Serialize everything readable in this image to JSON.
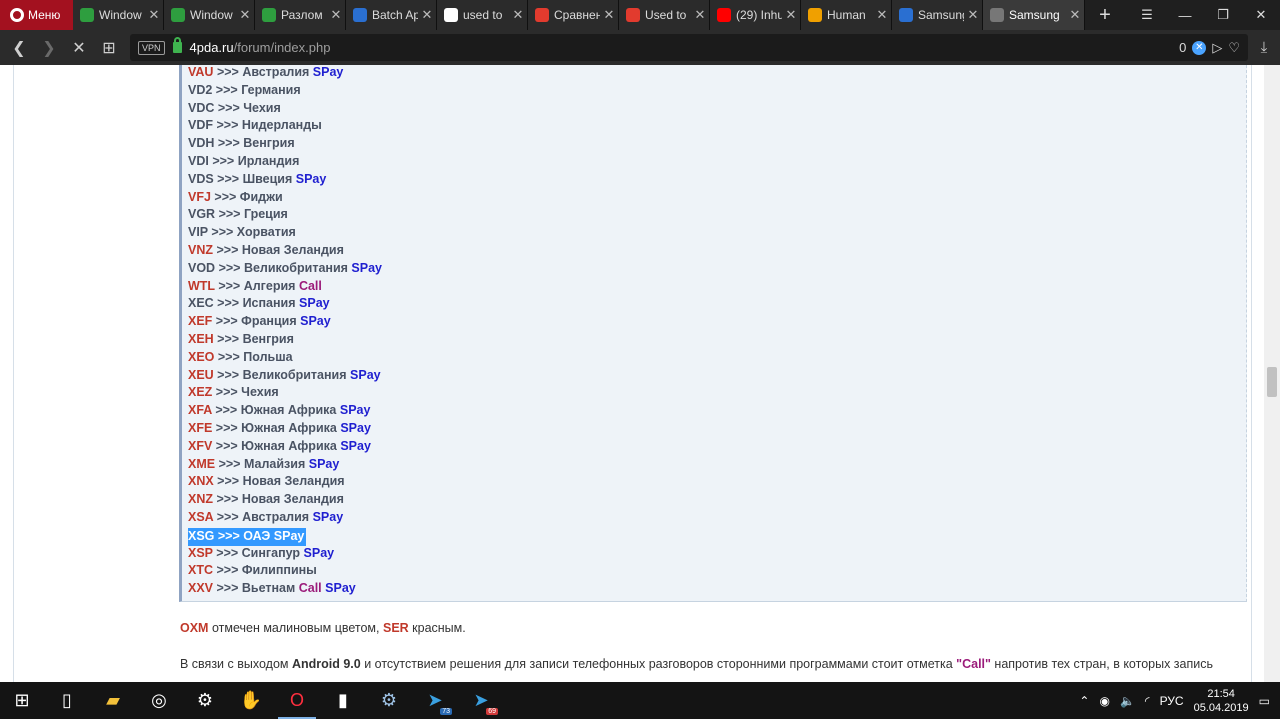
{
  "browser": {
    "menu_label": "Меню",
    "tabs": [
      {
        "title": "Window",
        "favicon_color": "#2e9e3f"
      },
      {
        "title": "Window",
        "favicon_color": "#2e9e3f"
      },
      {
        "title": "Разлом",
        "favicon_color": "#2e9e3f"
      },
      {
        "title": "Batch Ap",
        "favicon_color": "#2a6fd1"
      },
      {
        "title": "used to",
        "favicon_color": "#ffffff"
      },
      {
        "title": "Сравнен",
        "favicon_color": "#e23b2e"
      },
      {
        "title": "Used to",
        "favicon_color": "#e23b2e"
      },
      {
        "title": "(29) Inhu",
        "favicon_color": "#ff0000"
      },
      {
        "title": "Human",
        "favicon_color": "#f0a000"
      },
      {
        "title": "Samsung",
        "favicon_color": "#2a6fd1"
      },
      {
        "title": "Samsung",
        "favicon_color": "#777777",
        "active": true
      }
    ],
    "url_host": "4pda.ru",
    "url_path": "/forum/index.php",
    "vpn_label": "VPN",
    "adblock_count": "0"
  },
  "content": {
    "rows": [
      {
        "code": "VAU",
        "country": "Австралия",
        "spay": "SPay",
        "call": "",
        "code_red": true
      },
      {
        "code": "VD2",
        "country": "Германия",
        "spay": "",
        "call": "",
        "code_red": false
      },
      {
        "code": "VDC",
        "country": "Чехия",
        "spay": "",
        "call": "",
        "code_red": false
      },
      {
        "code": "VDF",
        "country": "Нидерланды",
        "spay": "",
        "call": "",
        "code_red": false
      },
      {
        "code": "VDH",
        "country": "Венгрия",
        "spay": "",
        "call": "",
        "code_red": false
      },
      {
        "code": "VDI",
        "country": "Ирландия",
        "spay": "",
        "call": "",
        "code_red": false
      },
      {
        "code": "VDS",
        "country": "Швеция",
        "spay": "SPay",
        "call": "",
        "code_red": false
      },
      {
        "code": "VFJ",
        "country": "Фиджи",
        "spay": "",
        "call": "",
        "code_red": true
      },
      {
        "code": "VGR",
        "country": "Греция",
        "spay": "",
        "call": "",
        "code_red": false
      },
      {
        "code": "VIP",
        "country": "Хорватия",
        "spay": "",
        "call": "",
        "code_red": false
      },
      {
        "code": "VNZ",
        "country": "Новая Зеландия",
        "spay": "",
        "call": "",
        "code_red": true
      },
      {
        "code": "VOD",
        "country": "Великобритания",
        "spay": "SPay",
        "call": "",
        "code_red": false
      },
      {
        "code": "WTL",
        "country": "Алгерия",
        "spay": "",
        "call": "Call",
        "code_red": true
      },
      {
        "code": "XEC",
        "country": "Испания",
        "spay": "SPay",
        "call": "",
        "code_red": false
      },
      {
        "code": "XEF",
        "country": "Франция",
        "spay": "SPay",
        "call": "",
        "code_red": true
      },
      {
        "code": "XEH",
        "country": "Венгрия",
        "spay": "",
        "call": "",
        "code_red": true
      },
      {
        "code": "XEO",
        "country": "Польша",
        "spay": "",
        "call": "",
        "code_red": true
      },
      {
        "code": "XEU",
        "country": "Великобритания",
        "spay": "SPay",
        "call": "",
        "code_red": true
      },
      {
        "code": "XEZ",
        "country": "Чехия",
        "spay": "",
        "call": "",
        "code_red": true
      },
      {
        "code": "XFA",
        "country": "Южная Африка",
        "spay": "SPay",
        "call": "",
        "code_red": true
      },
      {
        "code": "XFE",
        "country": "Южная Африка",
        "spay": "SPay",
        "call": "",
        "code_red": true
      },
      {
        "code": "XFV",
        "country": "Южная Африка",
        "spay": "SPay",
        "call": "",
        "code_red": true
      },
      {
        "code": "XME",
        "country": "Малайзия",
        "spay": "SPay",
        "call": "",
        "code_red": true
      },
      {
        "code": "XNX",
        "country": "Новая Зеландия",
        "spay": "",
        "call": "",
        "code_red": true
      },
      {
        "code": "XNZ",
        "country": "Новая Зеландия",
        "spay": "",
        "call": "",
        "code_red": true
      },
      {
        "code": "XSA",
        "country": "Австралия",
        "spay": "SPay",
        "call": "",
        "code_red": true
      },
      {
        "code": "XSG",
        "country": "ОАЭ",
        "spay": "SPay",
        "call": "",
        "code_red": true,
        "selected": true
      },
      {
        "code": "XSP",
        "country": "Сингапур",
        "spay": "SPay",
        "call": "",
        "code_red": true
      },
      {
        "code": "XTC",
        "country": "Филиппины",
        "spay": "",
        "call": "",
        "code_red": true
      },
      {
        "code": "XXV",
        "country": "Вьетнам",
        "spay": "SPay",
        "call": "Call",
        "code_red": true
      }
    ],
    "arrow": ">>>",
    "note": {
      "oxm": "OXM",
      "text1": " отмечен малиновым цветом, ",
      "ser": "SER",
      "text2": " красным."
    },
    "para": {
      "t1": "В связи с выходом ",
      "android": "Android 9.0",
      "t2": " и отсутствием решения для записи телефонных разговоров сторонними программами стоит отметка ",
      "call": "\"Call\"",
      "t3": " напротив тех стран, в которых запись"
    }
  },
  "taskbar": {
    "lang": "РУС",
    "time": "21:54",
    "date": "05.04.2019",
    "telegram_badge_1": "73",
    "telegram_badge_2": "69"
  },
  "colors": {
    "code_red": "#c0392b",
    "spay_blue": "#1f1fd0",
    "call_purple": "#9b1b7a",
    "selection": "#3399ff"
  }
}
